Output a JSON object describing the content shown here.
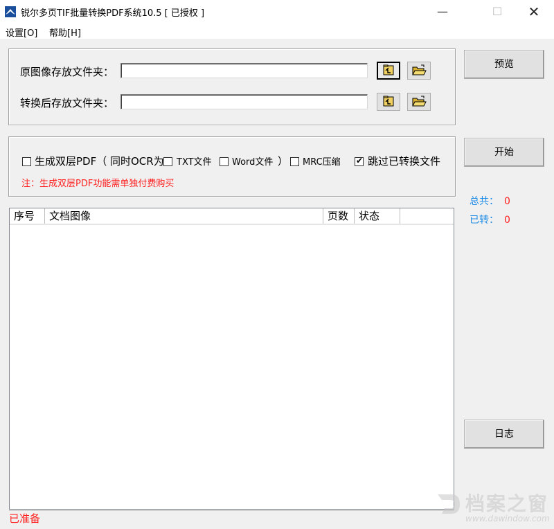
{
  "window": {
    "title": "锐尔多页TIF批量转换PDF系统10.5 [ 已授权 ]",
    "controls": {
      "minimize": "—",
      "maximize": "☐",
      "close": "✕"
    }
  },
  "menubar": {
    "items": [
      "设置[O]",
      "帮助[H]"
    ]
  },
  "folders": {
    "source_label": "原图像存放文件夹：",
    "source_value": "",
    "output_label": "转换后存放文件夹：",
    "output_value": ""
  },
  "options": {
    "dual_layer_pdf": {
      "label": "生成双层PDF（",
      "checked": false
    },
    "ocr_prefix": "同时OCR为",
    "txt_file": {
      "label": "TXT文件",
      "checked": false
    },
    "word_file": {
      "label": "Word文件",
      "checked": false
    },
    "close_paren": "）",
    "mrc_compress": {
      "label": "MRC压缩",
      "checked": false
    },
    "skip_converted": {
      "label": "跳过已转换文件",
      "checked": true
    },
    "note": "注：生成双层PDF功能需单独付费购买"
  },
  "buttons": {
    "preview": "预览",
    "start": "开始",
    "log": "日志"
  },
  "stats": {
    "total_label": "总共：",
    "total_value": "0",
    "done_label": "已转：",
    "done_value": "0"
  },
  "table": {
    "columns": [
      "序号",
      "文档图像",
      "页数",
      "状态"
    ],
    "rows": []
  },
  "status": {
    "text": "已准备"
  },
  "watermark": {
    "brand": "档案之窗",
    "url": "www.dawindow.com"
  },
  "colors": {
    "accent_blue": "#1e8ce6",
    "alert_red": "#ff2020",
    "chrome": "#f0f0f0"
  }
}
